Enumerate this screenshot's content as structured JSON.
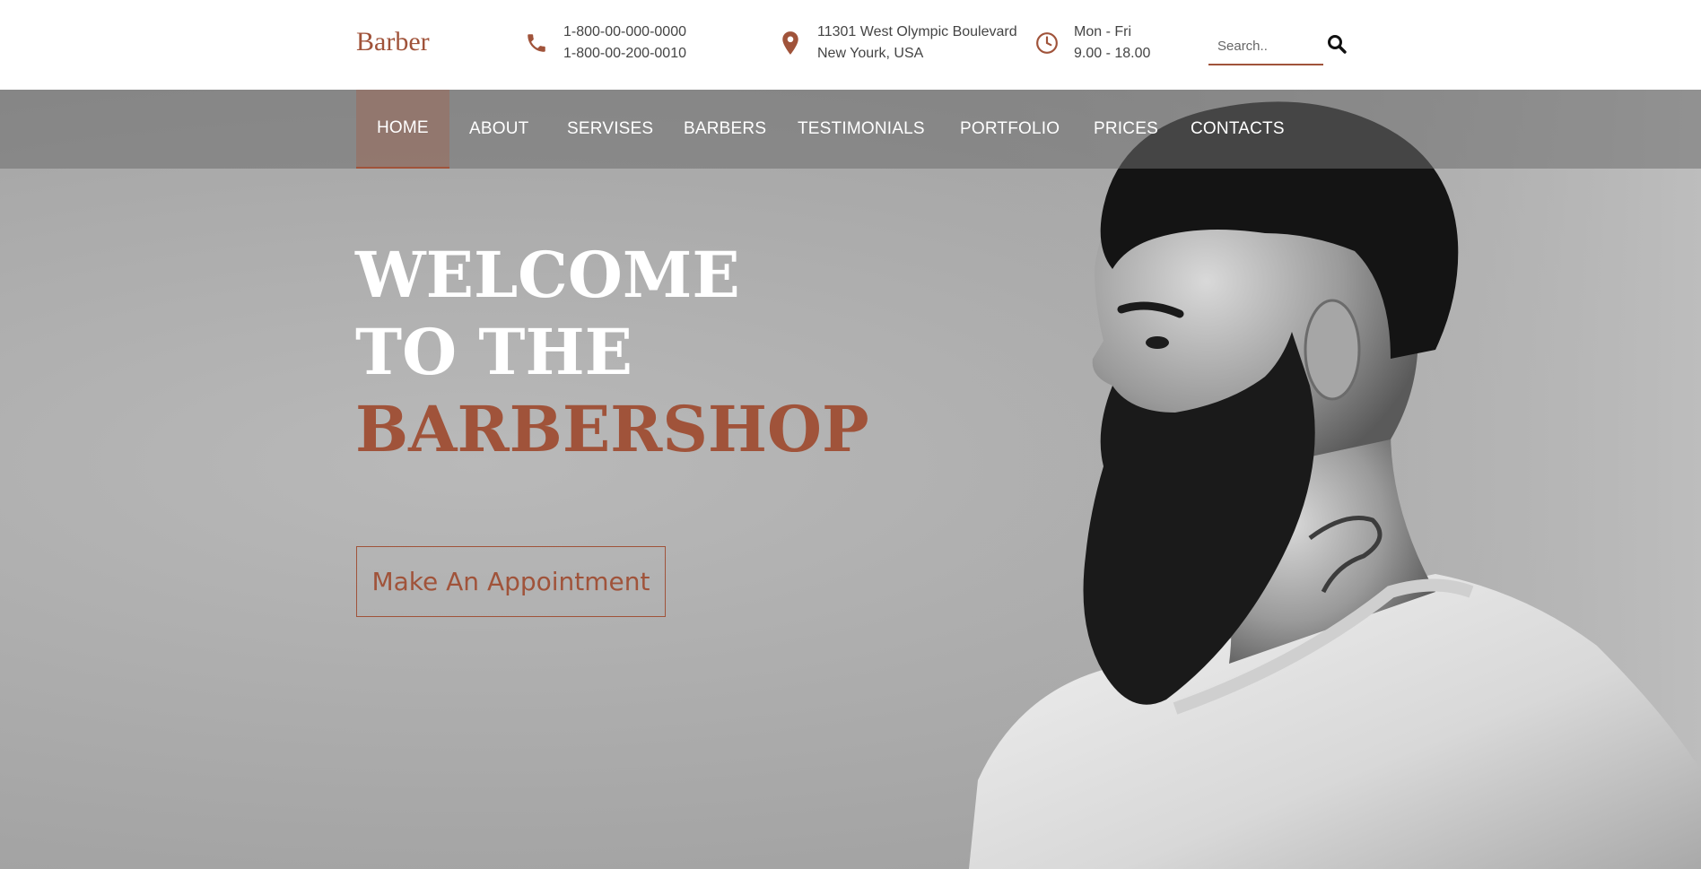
{
  "brand": {
    "name": "Barber",
    "accent_color": "#a0533a"
  },
  "contact": {
    "phone_icon": "phone-icon",
    "phone_lines": [
      "1-800-00-000-0000",
      "1-800-00-200-0010"
    ],
    "address_icon": "map-pin-icon",
    "address_lines": [
      "11301 West Olympic Boulevard",
      "New Yourk, USA"
    ],
    "hours_icon": "clock-icon",
    "hours_lines": [
      "Mon - Fri",
      "9.00 - 18.00"
    ]
  },
  "search": {
    "placeholder": "Search..",
    "value": "",
    "icon": "search-icon"
  },
  "nav": {
    "items": [
      {
        "label": "HOME",
        "active": true
      },
      {
        "label": "ABOUT"
      },
      {
        "label": "SERVISES"
      },
      {
        "label": "BARBERS"
      },
      {
        "label": "TESTIMONIALS"
      },
      {
        "label": "PORTFOLIO"
      },
      {
        "label": "PRICES"
      },
      {
        "label": "CONTACTS"
      }
    ]
  },
  "hero": {
    "line1": "WELCOME",
    "line2": "TO THE",
    "line3": "BARBERSHOP",
    "cta_label": "Make An Appointment"
  }
}
